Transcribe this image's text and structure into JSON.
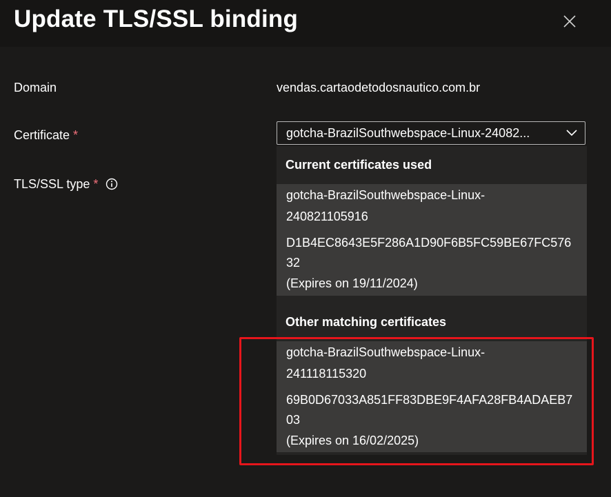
{
  "dialog": {
    "title": "Update TLS/SSL binding"
  },
  "form": {
    "domain_label": "Domain",
    "domain_value": "vendas.cartaodetodosnautico.com.br",
    "certificate_label": "Certificate",
    "certificate_required": "*",
    "certificate_selected": "gotcha-BrazilSouthwebspace-Linux-24082...",
    "tls_label": "TLS/SSL type",
    "tls_required": "*"
  },
  "dropdown": {
    "groups": [
      {
        "header": "Current certificates used",
        "options": [
          {
            "name_line1": "gotcha-BrazilSouthwebspace-Linux-",
            "name_line2": "240821105916",
            "thumb_line1": "D1B4EC8643E5F286A1D90F6B5FC59BE67FC576",
            "thumb_line2": "32",
            "expires": "(Expires on 19/11/2024)"
          }
        ]
      },
      {
        "header": "Other matching certificates",
        "options": [
          {
            "name_line1": "gotcha-BrazilSouthwebspace-Linux-",
            "name_line2": "241118115320",
            "thumb_line1": "69B0D67033A851FF83DBE9F4AFA28FB4ADAEB7",
            "thumb_line2": "03",
            "expires": "(Expires on 16/02/2025)"
          }
        ]
      }
    ]
  },
  "icons": {
    "close": "close-icon",
    "info": "info-icon",
    "chevron": "chevron-down-icon"
  },
  "colors": {
    "background": "#1b1a19",
    "option_background": "#3b3a39",
    "required_asterisk": "#f1707b",
    "highlight_box": "#e6151b"
  }
}
